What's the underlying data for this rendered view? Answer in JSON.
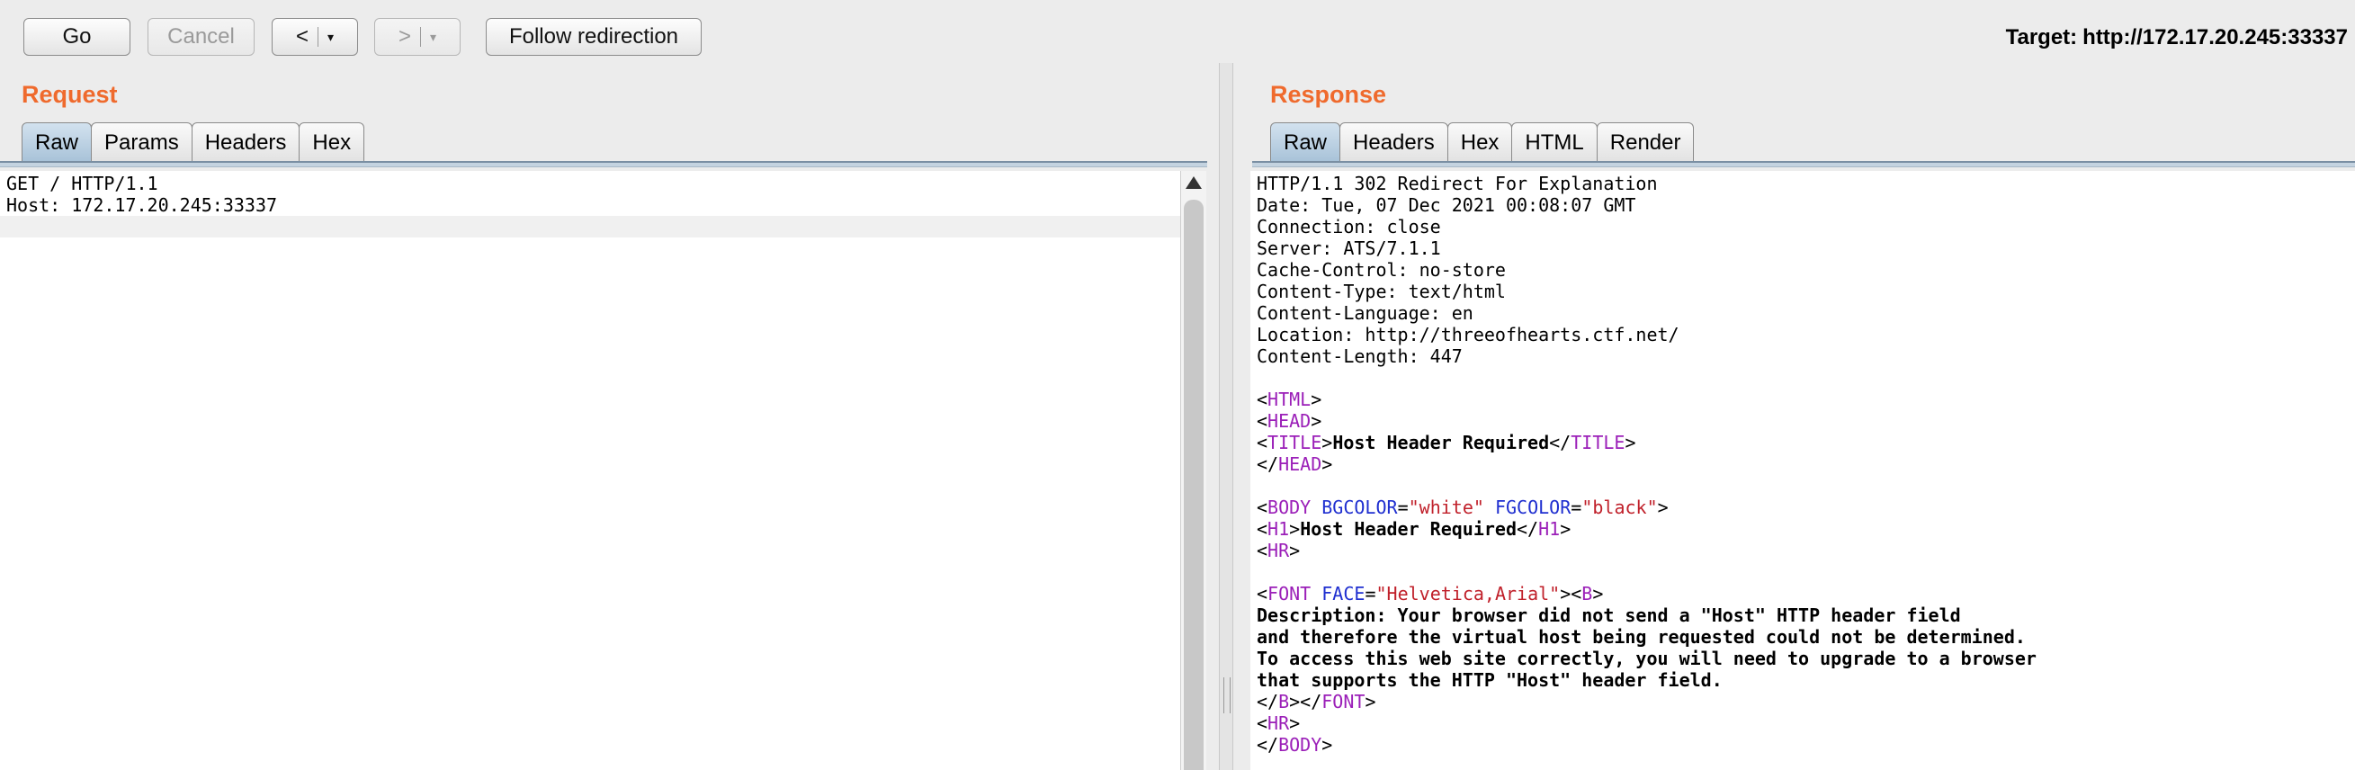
{
  "toolbar": {
    "go_label": "Go",
    "cancel_label": "Cancel",
    "back_label": "<",
    "back_dropdown": "▾",
    "forward_label": ">",
    "forward_dropdown": "▾",
    "follow_label": "Follow redirection",
    "target_label": "Target:",
    "target_value": "http://172.17.20.245:33337"
  },
  "request": {
    "title": "Request",
    "tabs": [
      "Raw",
      "Params",
      "Headers",
      "Hex"
    ],
    "active_tab": "Raw",
    "lines": [
      "GET / HTTP/1.1",
      "Host: 172.17.20.245:33337"
    ]
  },
  "response": {
    "title": "Response",
    "tabs": [
      "Raw",
      "Headers",
      "Hex",
      "HTML",
      "Render"
    ],
    "active_tab": "Raw",
    "headers": [
      "HTTP/1.1 302 Redirect For Explanation",
      "Date: Tue, 07 Dec 2021 00:08:07 GMT",
      "Connection: close",
      "Server: ATS/7.1.1",
      "Cache-Control: no-store",
      "Content-Type: text/html",
      "Content-Language: en",
      "Location: http://threeofhearts.ctf.net/",
      "Content-Length: 447"
    ],
    "body": {
      "title_text": "Host Header Required",
      "bgcolor": "white",
      "fgcolor": "black",
      "h1_text": "Host Header Required",
      "font_face": "Helvetica,Arial",
      "description_lines": [
        "Description: Your browser did not send a \"Host\" HTTP header field",
        "and therefore the virtual host being requested could not be determined.",
        "To access this web site correctly, you will need to upgrade to a browser",
        "that supports the HTTP \"Host\" header field."
      ]
    }
  },
  "colors": {
    "section_title": "#ef6a2d",
    "tag": "#9b1fb8",
    "attr": "#1f2fd0",
    "value": "#c0202a",
    "active_tab": "#a8c2d8"
  }
}
